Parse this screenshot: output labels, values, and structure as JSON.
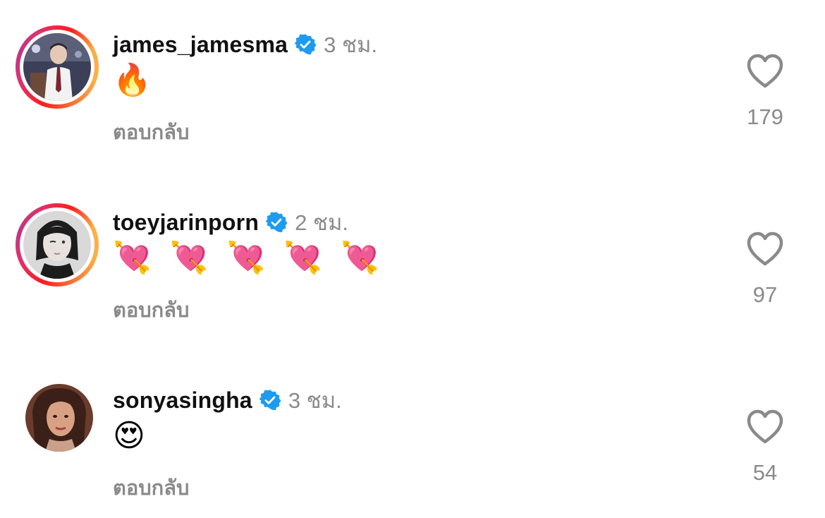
{
  "comments": [
    {
      "username": "james_jamesma",
      "time": "3 ชม.",
      "text": "🔥",
      "reply_label": "ตอบกลับ",
      "likes": "179",
      "verified": true,
      "story_ring": true,
      "like_icon": "heart-outline-icon"
    },
    {
      "username": "toeyjarinporn",
      "time": "2 ชม.",
      "text": "💘 💘 💘 💘 💘",
      "reply_label": "ตอบกลับ",
      "likes": "97",
      "verified": true,
      "story_ring": true,
      "like_icon": "heart-outline-icon"
    },
    {
      "username": "sonyasingha",
      "time": "3 ชม.",
      "text": "😍",
      "reply_label": "ตอบกลับ",
      "likes": "54",
      "verified": true,
      "story_ring": false,
      "like_icon": "heart-outline-icon"
    }
  ],
  "colors": {
    "verified_blue": "#1d9bf0",
    "muted_gray": "#8a8a8a",
    "text_dark": "#111111"
  }
}
